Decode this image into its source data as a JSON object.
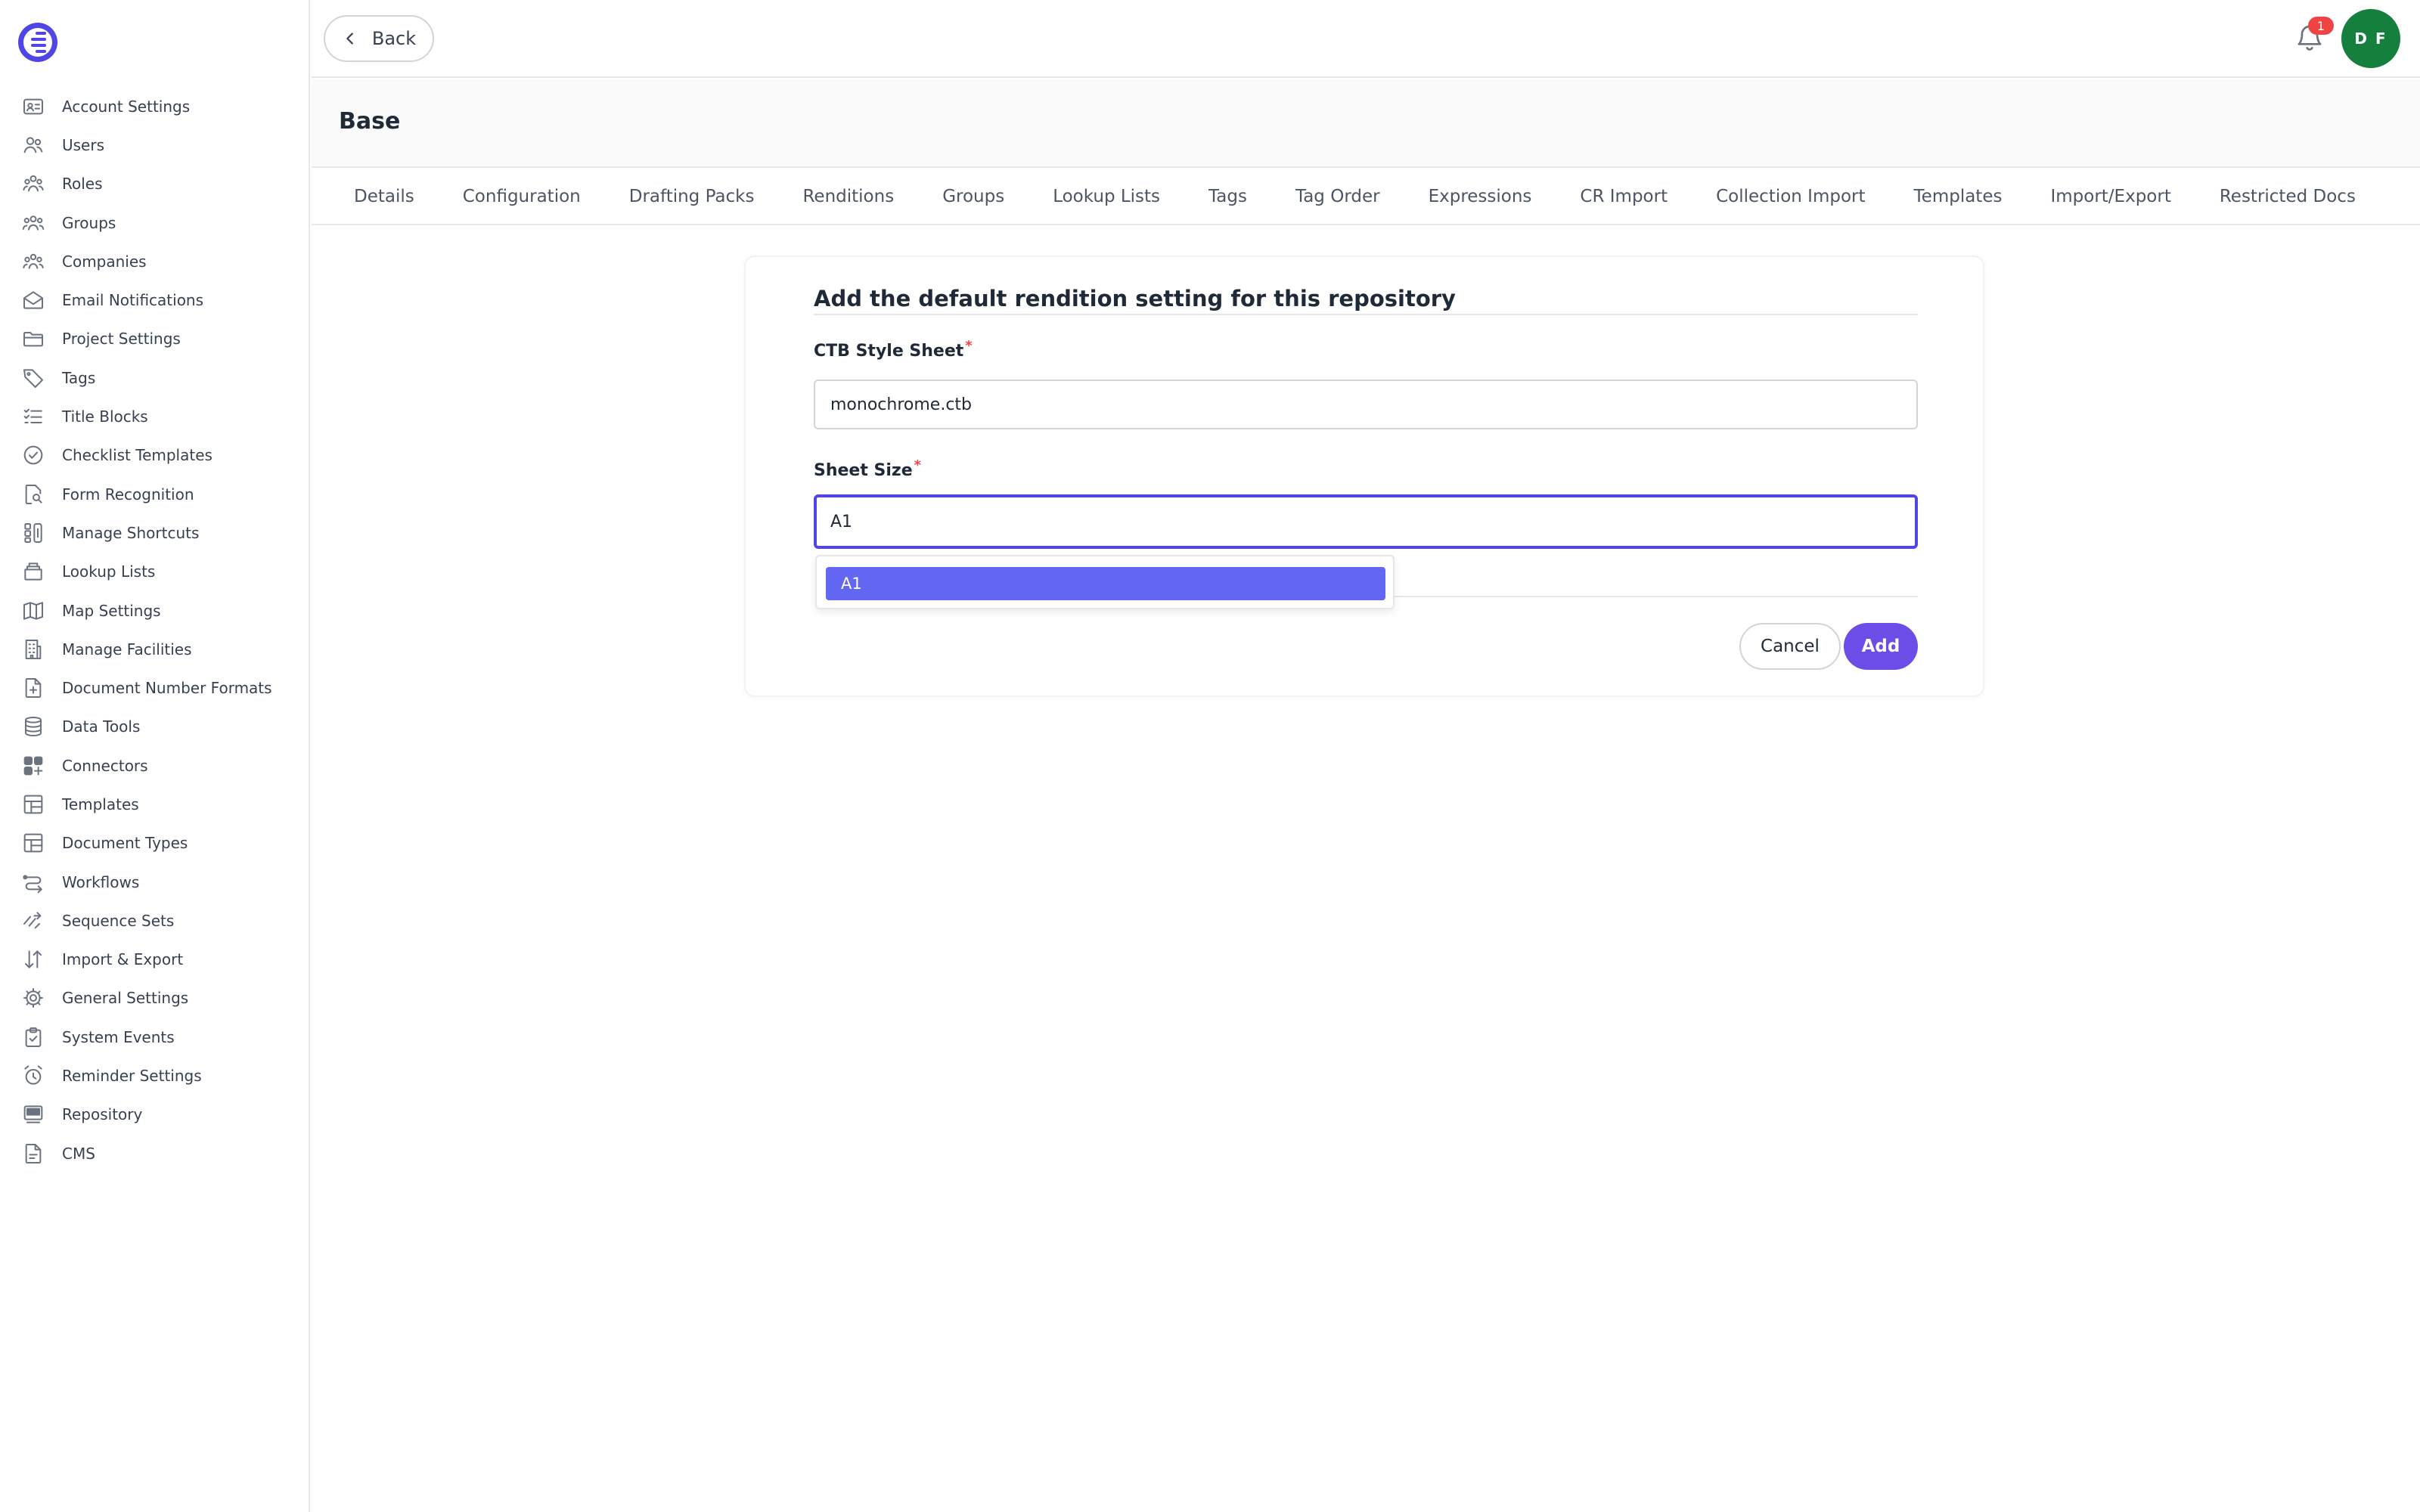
{
  "sidebar": {
    "items": [
      {
        "label": "Account Settings",
        "icon": "id-card-icon"
      },
      {
        "label": "Users",
        "icon": "users-icon"
      },
      {
        "label": "Roles",
        "icon": "roles-icon"
      },
      {
        "label": "Groups",
        "icon": "groups-icon"
      },
      {
        "label": "Companies",
        "icon": "companies-icon"
      },
      {
        "label": "Email Notifications",
        "icon": "mail-open-icon"
      },
      {
        "label": "Project Settings",
        "icon": "folder-icon"
      },
      {
        "label": "Tags",
        "icon": "tag-icon"
      },
      {
        "label": "Title Blocks",
        "icon": "checklist-icon"
      },
      {
        "label": "Checklist Templates",
        "icon": "check-circle-icon"
      },
      {
        "label": "Form Recognition",
        "icon": "file-search-icon"
      },
      {
        "label": "Manage Shortcuts",
        "icon": "shortcut-icon"
      },
      {
        "label": "Lookup Lists",
        "icon": "stack-icon"
      },
      {
        "label": "Map Settings",
        "icon": "map-icon"
      },
      {
        "label": "Manage Facilities",
        "icon": "building-icon"
      },
      {
        "label": "Document Number Formats",
        "icon": "file-plus-icon"
      },
      {
        "label": "Data Tools",
        "icon": "database-icon"
      },
      {
        "label": "Connectors",
        "icon": "grid-plus-icon"
      },
      {
        "label": "Templates",
        "icon": "layout-icon"
      },
      {
        "label": "Document Types",
        "icon": "layout-icon"
      },
      {
        "label": "Workflows",
        "icon": "workflow-icon"
      },
      {
        "label": "Sequence Sets",
        "icon": "sequence-icon"
      },
      {
        "label": "Import & Export",
        "icon": "arrows-updown-icon"
      },
      {
        "label": "General Settings",
        "icon": "gear-icon"
      },
      {
        "label": "System Events",
        "icon": "clipboard-check-icon"
      },
      {
        "label": "Reminder Settings",
        "icon": "alarm-icon"
      },
      {
        "label": "Repository",
        "icon": "repository-icon"
      },
      {
        "label": "CMS",
        "icon": "document-icon"
      }
    ]
  },
  "topbar": {
    "back_label": "Back",
    "notification_count": "1",
    "avatar_initials": "D F"
  },
  "page": {
    "title": "Base"
  },
  "tabs": [
    "Details",
    "Configuration",
    "Drafting Packs",
    "Renditions",
    "Groups",
    "Lookup Lists",
    "Tags",
    "Tag Order",
    "Expressions",
    "CR Import",
    "Collection Import",
    "Templates",
    "Import/Export",
    "Restricted Docs"
  ],
  "form": {
    "title": "Add the default rendition setting for this repository",
    "ctb_label": "CTB Style Sheet",
    "ctb_value": "monochrome.ctb",
    "sheet_label": "Sheet Size",
    "sheet_value": "A1",
    "required_mark": "*",
    "dropdown_options": [
      "A1"
    ],
    "cancel_label": "Cancel",
    "add_label": "Add"
  },
  "colors": {
    "accent": "#4f46e5",
    "primary_button": "#6d4de8",
    "dropdown_highlight": "#6366f1",
    "avatar": "#15803d",
    "badge": "#ef4444"
  }
}
